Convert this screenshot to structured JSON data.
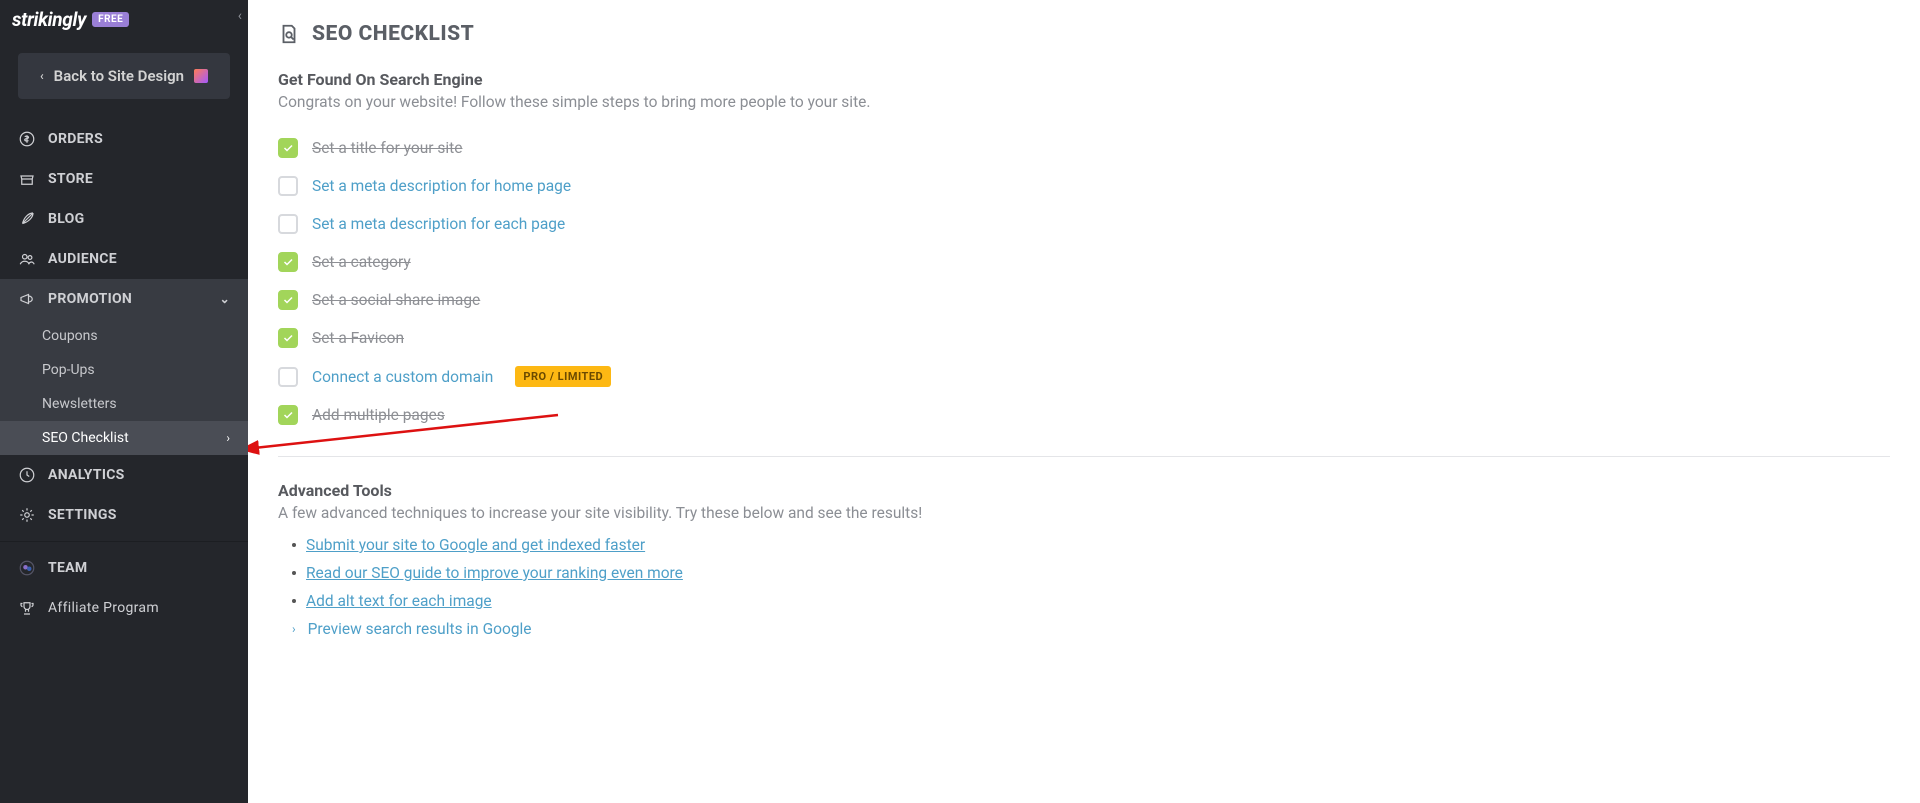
{
  "brand": {
    "logo": "strikingly",
    "badge": "FREE"
  },
  "back_button": "Back to Site Design",
  "nav": {
    "orders": "ORDERS",
    "store": "STORE",
    "blog": "BLOG",
    "audience": "AUDIENCE",
    "promotion": "PROMOTION",
    "analytics": "ANALYTICS",
    "settings": "SETTINGS",
    "team": "TEAM",
    "affiliate": "Affiliate Program"
  },
  "promo_sub": {
    "coupons": "Coupons",
    "popups": "Pop-Ups",
    "newsletters": "Newsletters",
    "seo": "SEO Checklist"
  },
  "page": {
    "title": "SEO CHECKLIST",
    "section1_h": "Get Found On Search Engine",
    "section1_sub": "Congrats on your website! Follow these simple steps to bring more people to your site.",
    "section2_h": "Advanced Tools",
    "section2_sub": "A few advanced techniques to increase your site visibility. Try these below and see the results!"
  },
  "checks": {
    "c1": "Set a title for your site",
    "c2": "Set a meta description for home page",
    "c3": "Set a meta description for each page",
    "c4": "Set a category",
    "c5": "Set a social share image",
    "c6": "Set a Favicon",
    "c7": "Connect a custom domain",
    "c7_badge": "PRO / LIMITED",
    "c8": "Add multiple pages"
  },
  "adv": {
    "a1": "Submit your site to Google and get indexed faster",
    "a2": "Read our SEO guide to improve your ranking even more",
    "a3": "Add alt text for each image",
    "a4": "Preview search results in Google"
  }
}
